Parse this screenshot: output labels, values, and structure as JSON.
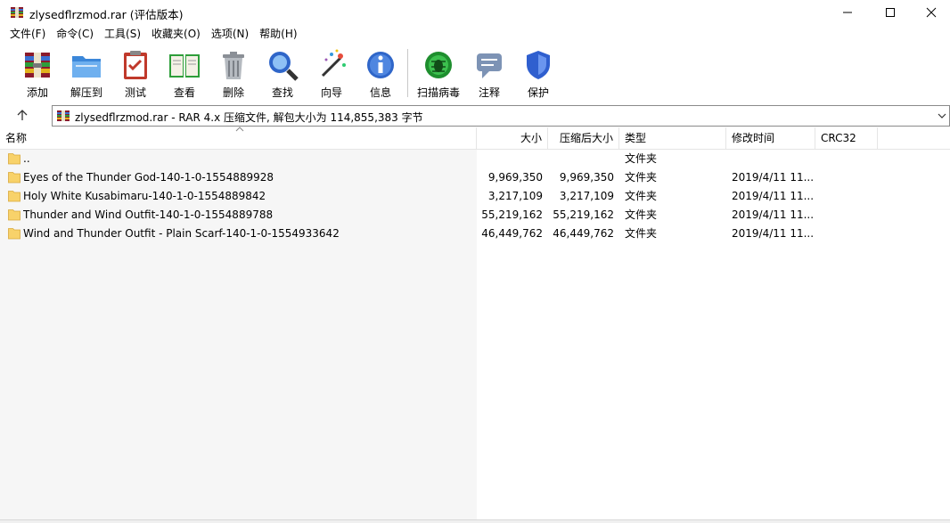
{
  "window": {
    "title": "zlysedflrzmod.rar (评估版本)",
    "icon": "winrar-archive-icon"
  },
  "menu": [
    {
      "label": "文件(F)"
    },
    {
      "label": "命令(C)"
    },
    {
      "label": "工具(S)"
    },
    {
      "label": "收藏夹(O)"
    },
    {
      "label": "选项(N)"
    },
    {
      "label": "帮助(H)"
    }
  ],
  "toolbar": [
    {
      "label": "添加",
      "icon": "add-archive-icon"
    },
    {
      "label": "解压到",
      "icon": "extract-folder-icon"
    },
    {
      "label": "测试",
      "icon": "test-clipboard-icon"
    },
    {
      "label": "查看",
      "icon": "view-book-icon"
    },
    {
      "label": "删除",
      "icon": "trash-icon"
    },
    {
      "label": "查找",
      "icon": "magnifier-icon"
    },
    {
      "label": "向导",
      "icon": "wizard-wand-icon"
    },
    {
      "label": "信息",
      "icon": "info-icon"
    },
    {
      "label": "扫描病毒",
      "icon": "virus-scan-icon"
    },
    {
      "label": "注释",
      "icon": "comment-icon"
    },
    {
      "label": "保护",
      "icon": "shield-icon"
    }
  ],
  "address": {
    "text": "zlysedflrzmod.rar - RAR 4.x 压缩文件, 解包大小为 114,855,383 字节"
  },
  "columns": {
    "name": "名称",
    "size": "大小",
    "packed": "压缩后大小",
    "type": "类型",
    "modified": "修改时间",
    "crc": "CRC32"
  },
  "rows": [
    {
      "name": "..",
      "size": "",
      "packed": "",
      "type": "文件夹",
      "modified": ""
    },
    {
      "name": "Eyes of the Thunder God-140-1-0-1554889928",
      "size": "9,969,350",
      "packed": "9,969,350",
      "type": "文件夹",
      "modified": "2019/4/11 11..."
    },
    {
      "name": "Holy White Kusabimaru-140-1-0-1554889842",
      "size": "3,217,109",
      "packed": "3,217,109",
      "type": "文件夹",
      "modified": "2019/4/11 11..."
    },
    {
      "name": "Thunder and Wind Outfit-140-1-0-1554889788",
      "size": "55,219,162",
      "packed": "55,219,162",
      "type": "文件夹",
      "modified": "2019/4/11 11..."
    },
    {
      "name": "Wind and Thunder Outfit - Plain Scarf-140-1-0-1554933642",
      "size": "46,449,762",
      "packed": "46,449,762",
      "type": "文件夹",
      "modified": "2019/4/11 11..."
    }
  ]
}
